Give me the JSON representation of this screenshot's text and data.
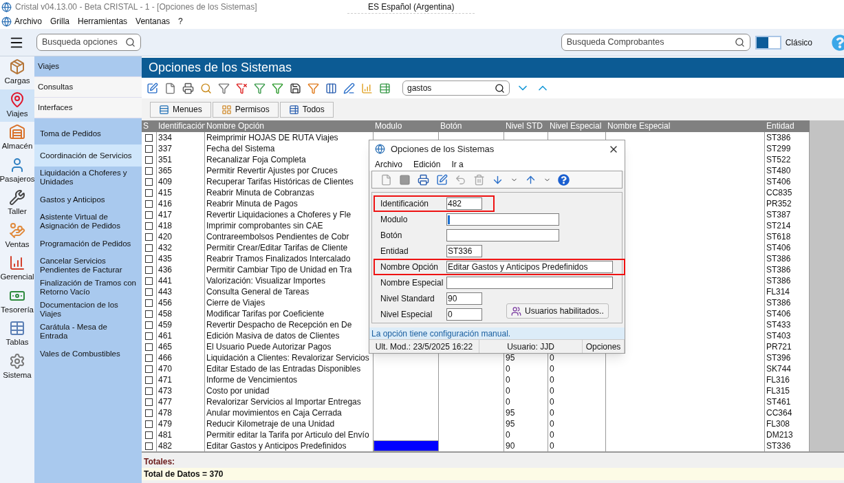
{
  "window": {
    "title": "Cristal v04.13.00 - Beta CRISTAL - 1 - [Opciones de los Sistemas]"
  },
  "language": "ES Español (Argentina)",
  "menu": [
    "Archivo",
    "Grilla",
    "Herramientas",
    "Ventanas",
    "?"
  ],
  "option_search": {
    "placeholder": "Busqueda opciones"
  },
  "voucher_search": {
    "placeholder": "Busqueda Comprobantes"
  },
  "classic_toggle": {
    "label": "Clásico",
    "on": false
  },
  "modules": [
    {
      "label": "Cargas",
      "selected": false
    },
    {
      "label": "Viajes",
      "selected": true
    },
    {
      "label": "Almacén",
      "selected": false
    },
    {
      "label": "Pasajeros",
      "selected": false
    },
    {
      "label": "Taller",
      "selected": false
    },
    {
      "label": "Ventas",
      "selected": false
    },
    {
      "label": "Gerencial",
      "selected": false
    },
    {
      "label": "Tesorería",
      "selected": false
    },
    {
      "label": "Tablas",
      "selected": false
    },
    {
      "label": "Sistema",
      "selected": false
    }
  ],
  "sections": [
    {
      "label": "Viajes",
      "selected": true
    },
    {
      "label": "Consultas",
      "selected": false
    },
    {
      "label": "Interfaces",
      "selected": false
    }
  ],
  "submenu": [
    {
      "label": "Toma de Pedidos",
      "selected": false
    },
    {
      "label": "Coordinación de Servicios",
      "selected": true
    },
    {
      "label": "Liquidación a Choferes y Unidades",
      "selected": false
    },
    {
      "label": "Gastos y Anticipos",
      "selected": false
    },
    {
      "label": "Asistente Virtual de Asignación de Pedidos",
      "selected": false
    },
    {
      "label": "Programación de Pedidos",
      "selected": false
    },
    {
      "label": "Cancelar Servicios Pendientes de Facturar",
      "selected": false
    },
    {
      "label": "Finalización de Tramos con Retorno Vacío",
      "selected": false
    },
    {
      "label": "Documentacion de los Viajes",
      "selected": false
    },
    {
      "label": "Carátula - Mesa de Entrada",
      "selected": false
    },
    {
      "label": "Vales de Combustibles",
      "selected": false
    }
  ],
  "panel": {
    "title": "Opciones de los Sistemas",
    "search": {
      "value": "gastos"
    },
    "view_buttons": [
      "Menues",
      "Permisos",
      "Todos"
    ]
  },
  "table": {
    "columns": [
      "S",
      "Identificación",
      "Nombre Opción",
      "Modulo",
      "Botón",
      "Nivel STD",
      "Nivel Especial",
      "Nombre Especial",
      "Entidad"
    ],
    "rows": [
      {
        "checked": false,
        "id": "334",
        "name": "Reimprimir HOJAS DE RUTA Viajes",
        "entidad": "ST386"
      },
      {
        "checked": false,
        "id": "337",
        "name": "Fecha del Sistema",
        "entidad": "ST299"
      },
      {
        "checked": false,
        "id": "351",
        "name": "Recanalizar Foja Completa",
        "entidad": "ST522"
      },
      {
        "checked": false,
        "id": "365",
        "name": "Permitir Revertir Ajustes por Cruces",
        "entidad": "ST480"
      },
      {
        "checked": false,
        "id": "409",
        "name": "Recuperar Tarifas Históricas de Clientes",
        "entidad": "ST406"
      },
      {
        "checked": false,
        "id": "415",
        "name": "Reabrir Minuta de Cobranzas",
        "entidad": "CC835"
      },
      {
        "checked": false,
        "id": "416",
        "name": "Reabrir Minuta de Pagos",
        "entidad": "PR352"
      },
      {
        "checked": false,
        "id": "417",
        "name": "Revertir Liquidaciones a Choferes y Fle",
        "entidad": "ST387"
      },
      {
        "checked": false,
        "id": "418",
        "name": "Imprimir comprobantes sin CAE",
        "entidad": "ST214"
      },
      {
        "checked": false,
        "id": "420",
        "name": "Contrareembolsos Pendientes de Cobr",
        "entidad": "ST618"
      },
      {
        "checked": false,
        "id": "432",
        "name": "Permitir Crear/Editar Tarifas de Cliente",
        "entidad": "ST406"
      },
      {
        "checked": false,
        "id": "435",
        "name": "Reabrir Tramos Finalizados Intercalado",
        "entidad": "ST386"
      },
      {
        "checked": false,
        "id": "436",
        "name": "Permitir Cambiar Tipo de Unidad en Tra",
        "entidad": "ST386"
      },
      {
        "checked": false,
        "id": "441",
        "name": "Valorización: Visualizar Importes",
        "entidad": "ST386"
      },
      {
        "checked": false,
        "id": "443",
        "name": "Consulta General de Tareas",
        "entidad": "FL314"
      },
      {
        "checked": false,
        "id": "456",
        "name": "Cierre de Viajes",
        "entidad": "ST386"
      },
      {
        "checked": false,
        "id": "458",
        "name": "Modificar Tarifas por Coeficiente",
        "entidad": "ST406"
      },
      {
        "checked": false,
        "id": "459",
        "name": "Revertir Despacho de Recepción en De",
        "entidad": "ST433"
      },
      {
        "checked": false,
        "id": "461",
        "name": "Edición Masiva de datos de Clientes",
        "entidad": "ST403"
      },
      {
        "checked": false,
        "id": "465",
        "name": "El Usuario Puede Autorizar Pagos",
        "entidad": "PR721"
      },
      {
        "checked": false,
        "selected": false,
        "id": "466",
        "name": "Liquidación a Clientes: Revalorizar Servicios",
        "nivel_std": "95",
        "nivel_especial": "0",
        "entidad": "ST396"
      },
      {
        "checked": false,
        "selected": false,
        "id": "470",
        "name": "Editar Estado de las Entradas Disponibles",
        "nivel_std": "0",
        "nivel_especial": "0",
        "entidad": "SK744"
      },
      {
        "checked": false,
        "selected": false,
        "id": "471",
        "name": "Informe de Vencimientos",
        "nivel_std": "0",
        "nivel_especial": "0",
        "entidad": "FL316"
      },
      {
        "checked": false,
        "selected": false,
        "id": "473",
        "name": "Costo por unidad",
        "nivel_std": "0",
        "nivel_especial": "0",
        "entidad": "FL315"
      },
      {
        "checked": false,
        "selected": false,
        "id": "477",
        "name": "Revalorizar Servicios al Importar Entregas",
        "nivel_std": "0",
        "nivel_especial": "0",
        "entidad": "ST461"
      },
      {
        "checked": false,
        "selected": false,
        "id": "478",
        "name": "Anular movimientos en Caja Cerrada",
        "nivel_std": "95",
        "nivel_especial": "0",
        "entidad": "CC364"
      },
      {
        "checked": false,
        "selected": false,
        "id": "479",
        "name": "Reducir Kilometraje de una Unidad",
        "nivel_std": "95",
        "nivel_especial": "0",
        "entidad": "FL308"
      },
      {
        "checked": false,
        "selected": false,
        "id": "481",
        "name": "Permitir editar la Tarifa por Articulo del Envío",
        "nivel_std": "0",
        "nivel_especial": "0",
        "entidad": "DM213"
      },
      {
        "checked": false,
        "selected": true,
        "id": "482",
        "name": "Editar Gastos y Anticipos Predefinidos",
        "nivel_std": "90",
        "nivel_especial": "0",
        "entidad": "ST336"
      }
    ]
  },
  "totals": {
    "label": "Totales:",
    "count": "Total de Datos = 370"
  },
  "dialog": {
    "title": "Opciones de los Sistemas",
    "menu": [
      "Archivo",
      "Edición",
      "Ir a"
    ],
    "fields": [
      {
        "label": "Identificación",
        "value": "482",
        "highlighted": true,
        "focused": false
      },
      {
        "label": "Modulo",
        "highlighted": false,
        "focused": true
      },
      {
        "label": "Botón",
        "highlighted": false,
        "focused": false
      },
      {
        "label": "Entidad",
        "value": "ST336",
        "highlighted": false,
        "focused": false
      },
      {
        "label": "Nombre Opción",
        "value": "Editar Gastos y Anticipos Predefinidos",
        "highlighted": true,
        "focused": false
      },
      {
        "label": "Nombre Especial",
        "highlighted": false,
        "focused": false
      },
      {
        "label": "Nivel Standard",
        "value": "90",
        "highlighted": false,
        "focused": false
      },
      {
        "label": "Nivel Especial",
        "value": "0",
        "highlighted": false,
        "focused": false
      }
    ],
    "users_button": "Usuarios habilitados..",
    "info": "La opción tiene configuración manual.",
    "status": [
      "Ult. Mod.: 23/5/2025 16:22",
      "Usuario: JJD",
      "Opciones"
    ]
  }
}
